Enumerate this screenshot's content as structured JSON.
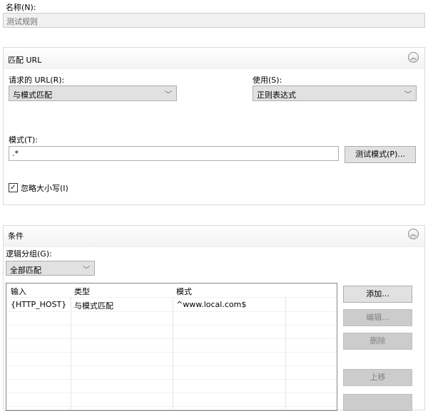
{
  "name": {
    "label": "名称(N):",
    "value": "测试规则"
  },
  "match_url": {
    "title": "匹配 URL",
    "requested_url_label": "请求的 URL(R):",
    "requested_url_value": "与模式匹配",
    "using_label": "使用(S):",
    "using_value": "正则表达式",
    "pattern_label": "模式(T):",
    "pattern_value": ".*",
    "test_pattern_button": "测试模式(P)...",
    "ignore_case_label": "忽略大小写(I)",
    "ignore_case_checked": true
  },
  "conditions": {
    "title": "条件",
    "logical_grouping_label": "逻辑分组(G):",
    "logical_grouping_value": "全部匹配",
    "columns": [
      "输入",
      "类型",
      "模式"
    ],
    "rows": [
      {
        "input": "{HTTP_HOST}",
        "type": "与模式匹配",
        "pattern": "^www.local.com$"
      }
    ],
    "buttons": {
      "add": "添加...",
      "edit": "编辑...",
      "remove": "删除",
      "move_up": "上移"
    }
  }
}
